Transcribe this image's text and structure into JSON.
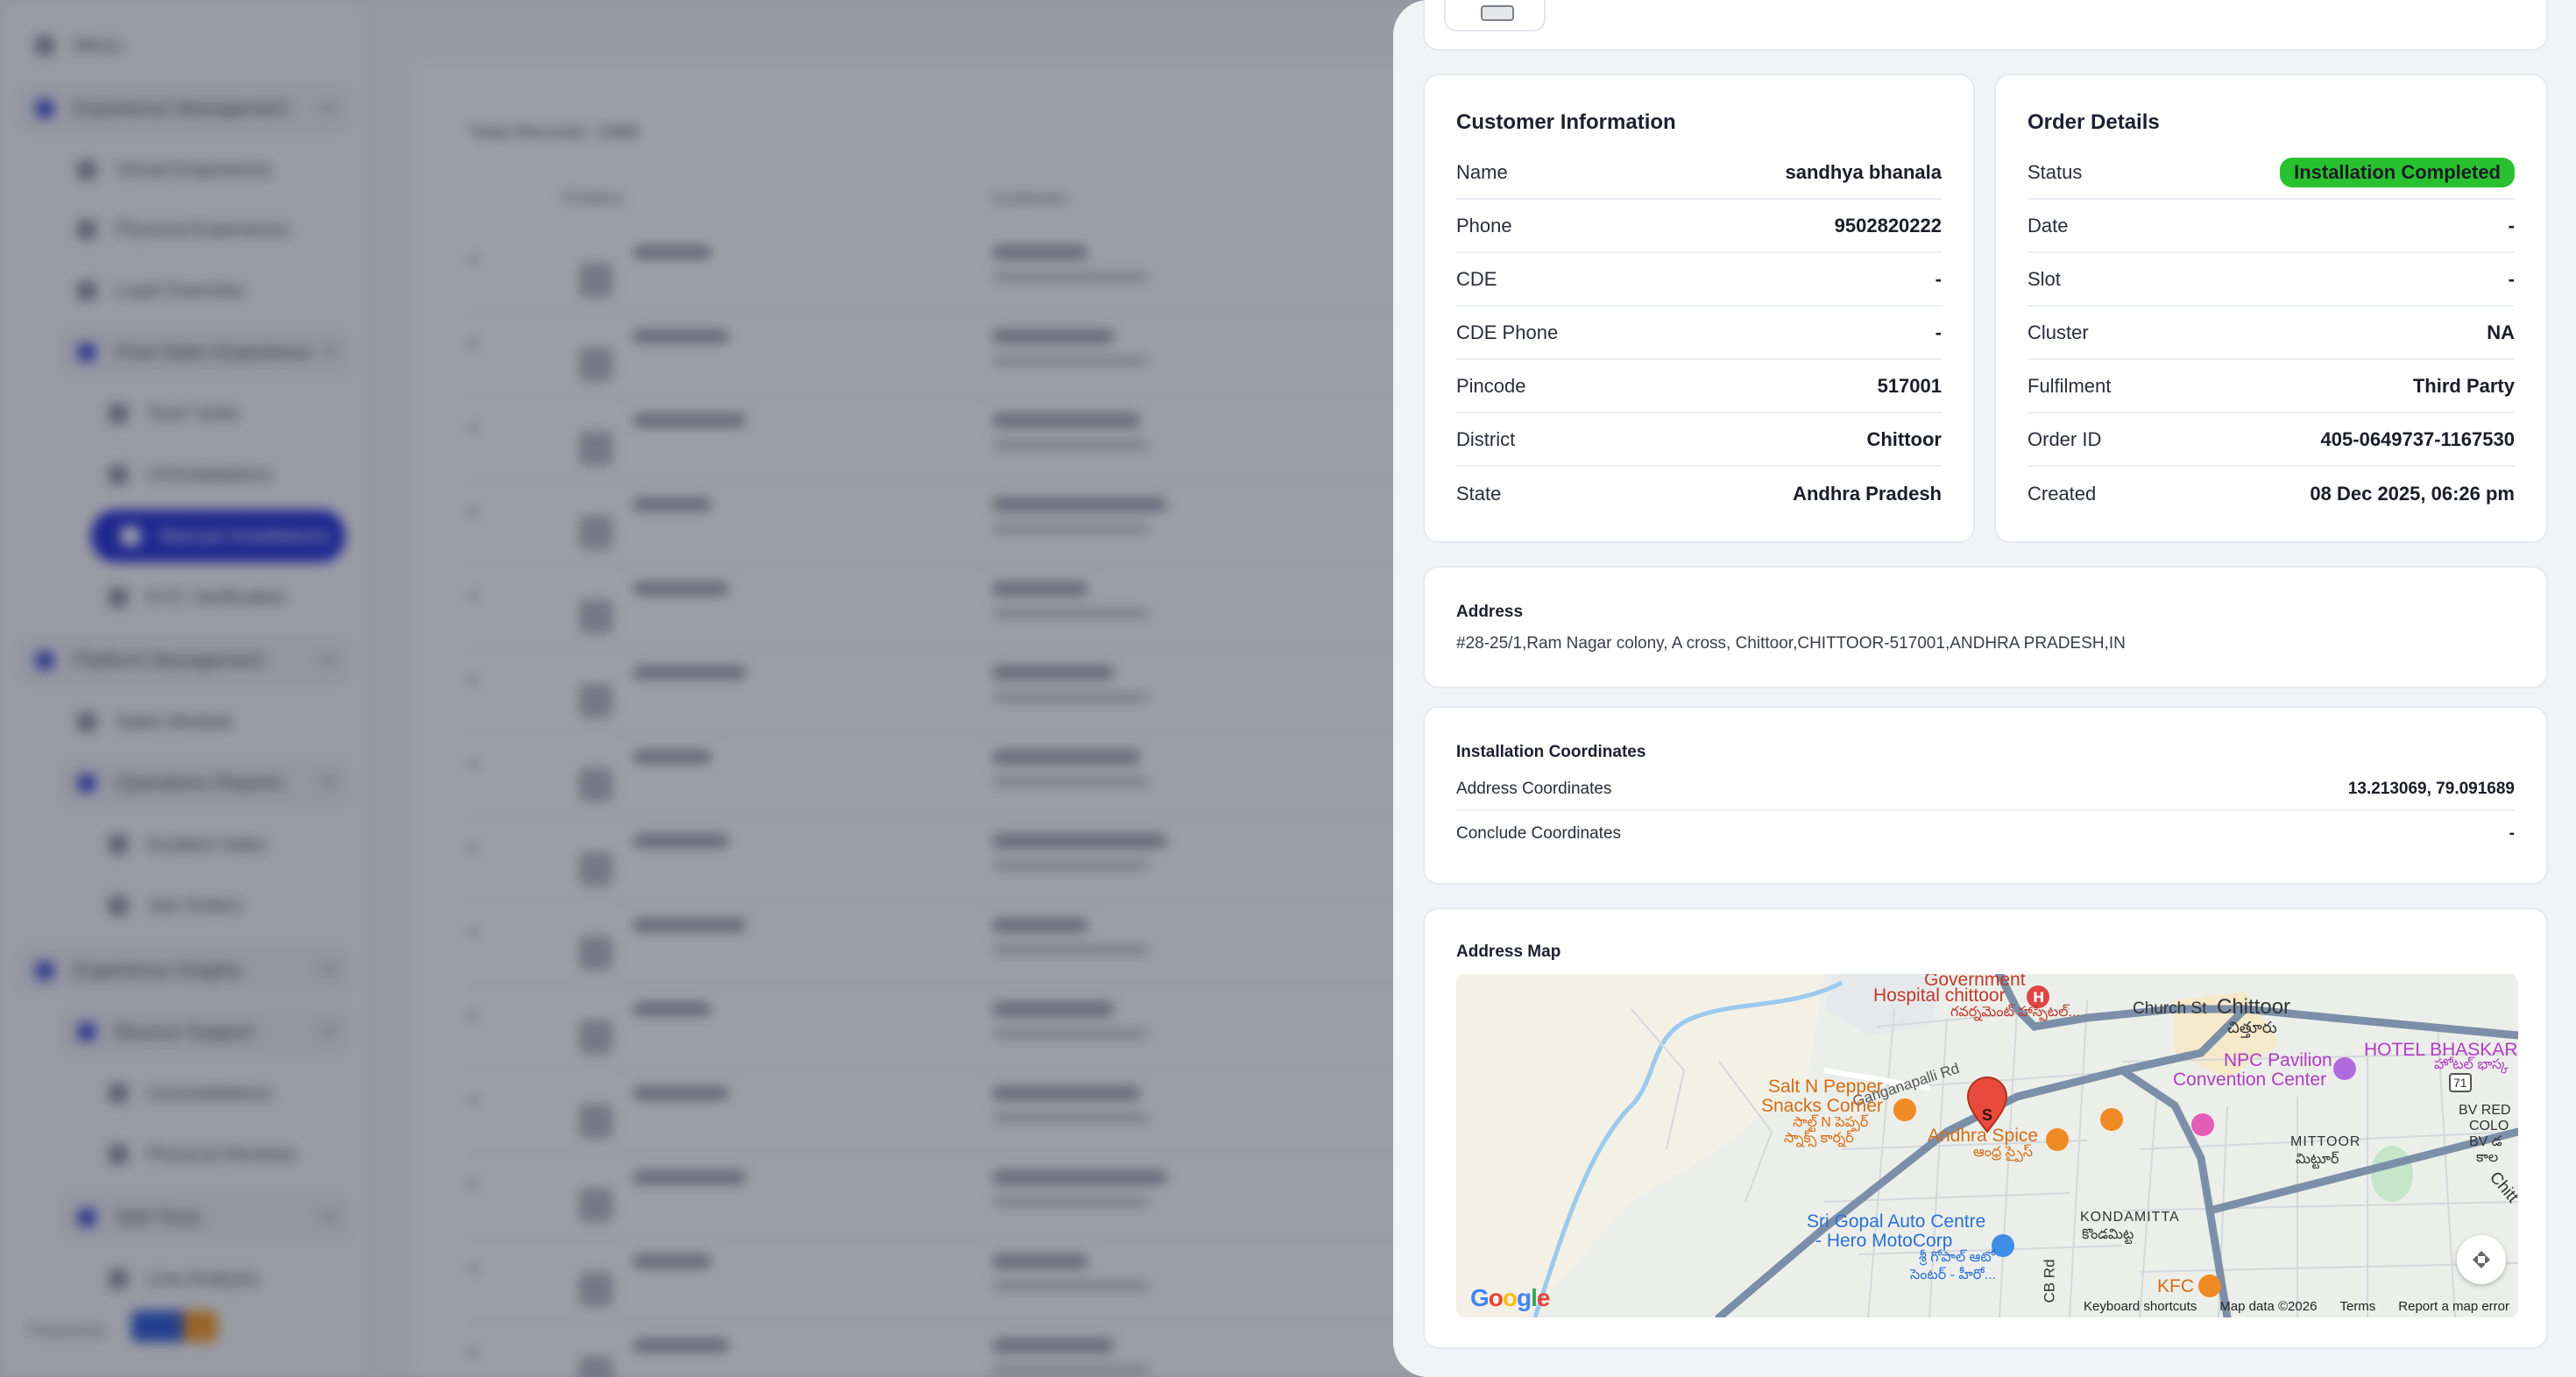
{
  "customer": {
    "title": "Customer Information",
    "rows": [
      {
        "label": "Name",
        "value": "sandhya bhanala"
      },
      {
        "label": "Phone",
        "value": "9502820222"
      },
      {
        "label": "CDE",
        "value": "-"
      },
      {
        "label": "CDE Phone",
        "value": "-"
      },
      {
        "label": "Pincode",
        "value": "517001"
      },
      {
        "label": "District",
        "value": "Chittoor"
      },
      {
        "label": "State",
        "value": "Andhra Pradesh"
      }
    ]
  },
  "order": {
    "title": "Order Details",
    "status_label": "Status",
    "status_value": "Installation Completed",
    "status_color": "#29c12f",
    "rows": [
      {
        "label": "Date",
        "value": "-"
      },
      {
        "label": "Slot",
        "value": "-"
      },
      {
        "label": "Cluster",
        "value": "NA"
      },
      {
        "label": "Fulfilment",
        "value": "Third Party"
      },
      {
        "label": "Order ID",
        "value": "405-0649737-1167530"
      },
      {
        "label": "Created",
        "value": "08 Dec 2025, 06:26 pm"
      }
    ]
  },
  "address": {
    "title": "Address",
    "text": "#28-25/1,Ram Nagar colony, A cross, Chittoor,CHITTOOR-517001,ANDHRA PRADESH,IN"
  },
  "coordinates": {
    "title": "Installation Coordinates",
    "address_label": "Address Coordinates",
    "address_value": "13.213069, 79.091689",
    "conclude_label": "Conclude Coordinates",
    "conclude_value": "-"
  },
  "map": {
    "title": "Address Map",
    "marker_letter": "S",
    "labels": {
      "government": "Government",
      "hospital": "Hospital chittoor",
      "hospital_te": "గవర్నమెంట్ హాస్పిటల్...",
      "church_st": "Church St",
      "chittoor": "Chittoor",
      "chittoor_te": "చిత్తూరు",
      "hotel": "HOTEL BHASKARA",
      "hotel_te": "హోటల్ భాస్క",
      "npc1": "NPC Pavilion",
      "npc2": "Convention Center",
      "ganganapalli": "Ganganapalli Rd",
      "salt1": "Salt N Pepper",
      "salt2": "Snacks Corner",
      "salt_te1": "సాల్ట్ N పెప్పర్",
      "salt_te2": "స్నాక్స్ కార్నర్",
      "andhra": "Andhra Spice",
      "andhra_te": "ఆంధ్ర స్పైస్",
      "route": "71",
      "bv1": "BV RED",
      "bv2": "COLO",
      "bv3": "BV డ",
      "bv4": "కాల",
      "mittoor": "MITTOOR",
      "mittoor_te": "మిట్టూర్",
      "chitt_side": "Chitt",
      "kondamitta": "KONDAMITTA",
      "kondamitta_te": "కొండమిట్ట",
      "sri1": "Sri Gopal Auto Centre",
      "sri2": "- Hero MotoCorp",
      "sri_te1": "శ్రీ గోపాల్ ఆటో",
      "sri_te2": "సెంటర్ - హీరో...",
      "cb_rd": "CB Rd",
      "kfc": "KFC"
    },
    "google": [
      "G",
      "o",
      "o",
      "g",
      "l",
      "e"
    ],
    "attrib": {
      "shortcuts": "Keyboard shortcuts",
      "data": "Map data ©2026",
      "terms": "Terms",
      "report": "Report a map error"
    }
  },
  "background": {
    "sidebar": {
      "top": "Menu",
      "g1": "Experience Management",
      "i1": "Virtual Experience",
      "i2": "Physical Experience",
      "i3": "Lead Overview",
      "g2": "Post-Sales Experience",
      "i4": "Tech Visits",
      "i5": "Uninstallations",
      "i6": "Manual Installations",
      "i7": "KYC Verification",
      "g3": "Platform Management",
      "i8": "Sales Module",
      "g4": "Operations Reports",
      "i9": "Incident Index",
      "i10": "Job Orders",
      "g5": "Experience Insights",
      "g6": "Bounce Support",
      "i11": "Uninstallations",
      "i12": "Physical Reviews",
      "g7": "Skill Tests",
      "i13": "Live Analysis",
      "footer": "Powered by"
    },
    "main": {
      "count": "Total Records: 2986",
      "col1": "Product",
      "col2": "Customer"
    }
  }
}
